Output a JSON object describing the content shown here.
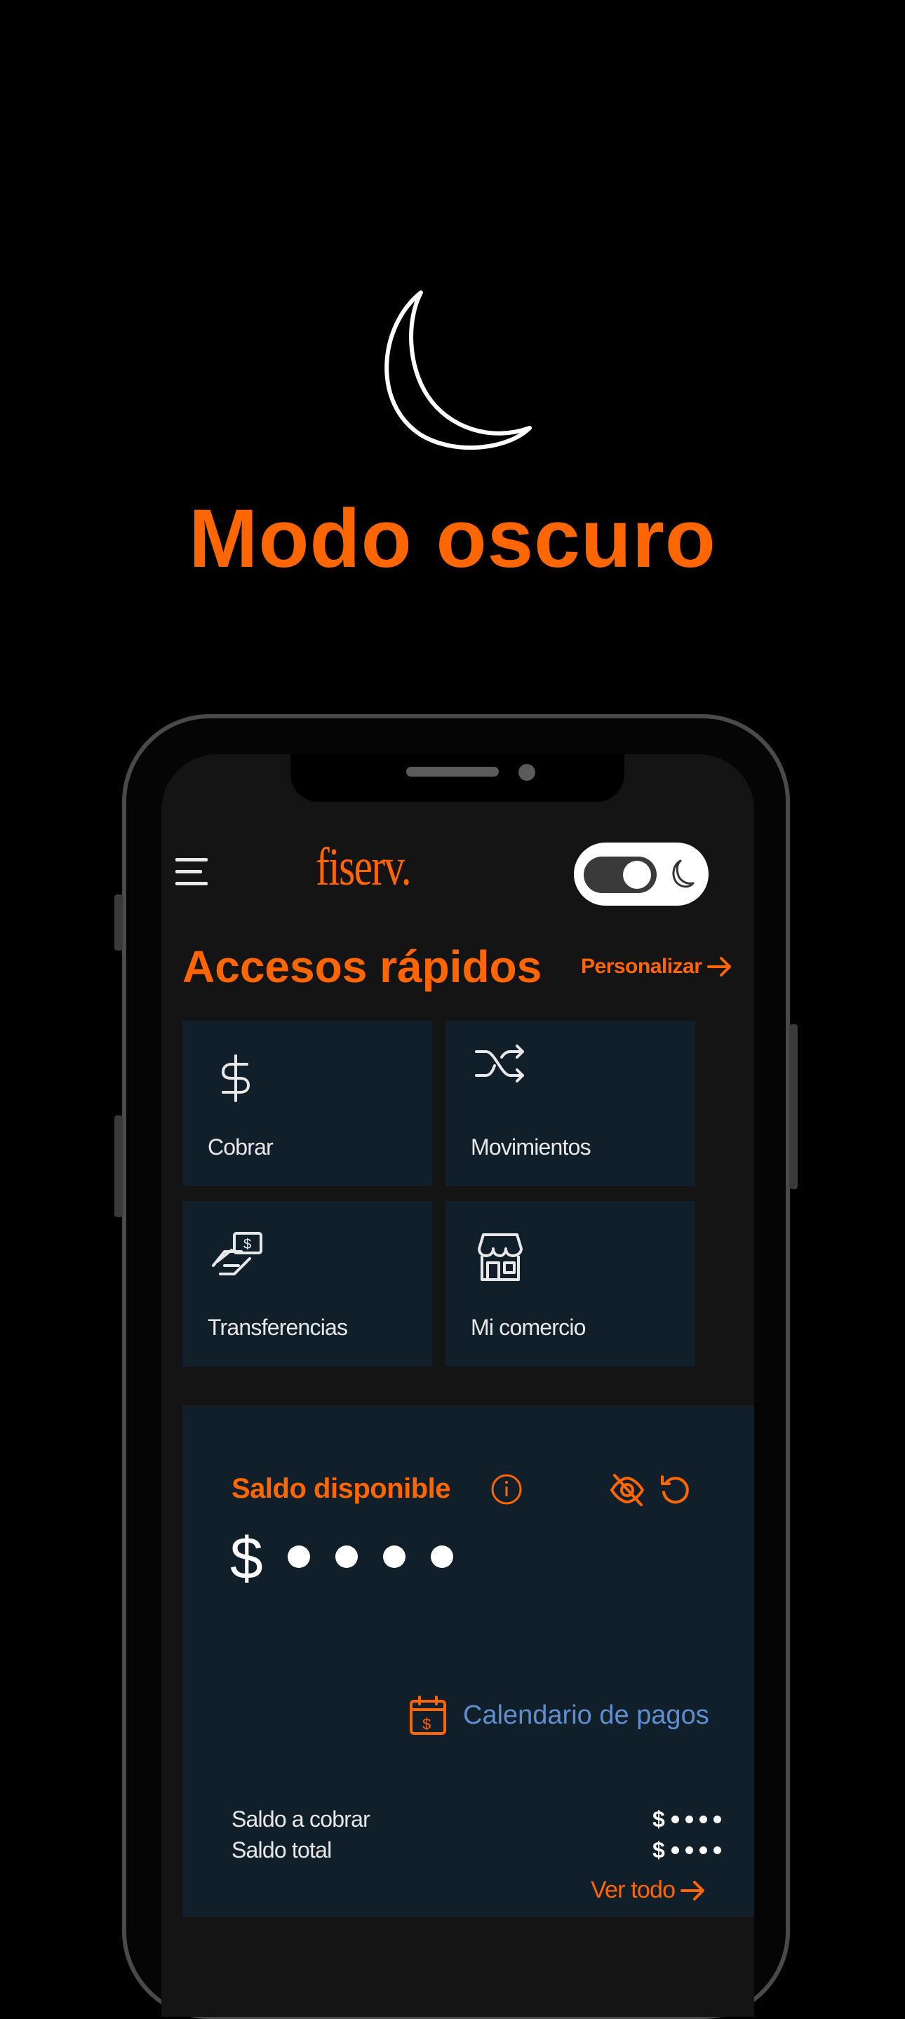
{
  "header": {
    "moon_icon": "crescent-moon-icon",
    "headline": "Modo oscuro"
  },
  "app": {
    "logo": "fiserv.",
    "theme_toggle": {
      "state": "dark",
      "icon": "moon-icon"
    },
    "quick_access": {
      "title": "Accesos rápidos",
      "customize_label": "Personalizar",
      "tiles": [
        {
          "label": "Cobrar",
          "icon": "dollar-icon"
        },
        {
          "label": "Movimientos",
          "icon": "shuffle-icon"
        },
        {
          "label": "Transferencias",
          "icon": "hand-money-icon"
        },
        {
          "label": "Mi comercio",
          "icon": "store-icon"
        }
      ]
    },
    "balance": {
      "title": "Saldo disponible",
      "currency": "$",
      "masked_value": "••••",
      "calendar_label": "Calendario de pagos",
      "rows": [
        {
          "label": "Saldo a cobrar",
          "currency": "$",
          "masked_value": "••••"
        },
        {
          "label": "Saldo total",
          "currency": "$",
          "masked_value": "••••"
        }
      ],
      "see_all_label": "Ver todo"
    }
  },
  "colors": {
    "accent": "#ff6600",
    "card": "#101f2a",
    "screen_bg": "#141414",
    "link_blue": "#5f8fcf"
  }
}
